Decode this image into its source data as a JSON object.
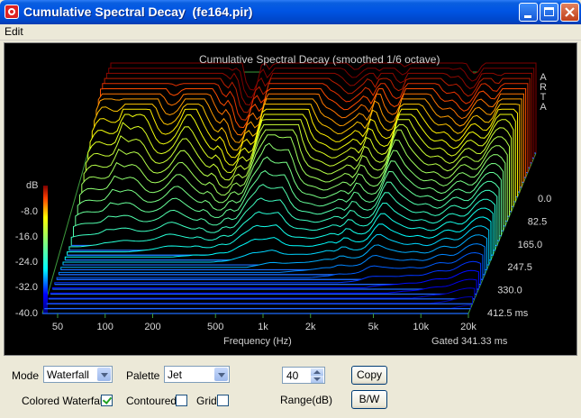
{
  "window": {
    "title": "Cumulative Spectral Decay  (fe164.pir)"
  },
  "menu": {
    "edit": "Edit"
  },
  "plot": {
    "title": "Cumulative Spectral Decay (smoothed 1/6 octave)",
    "watermark": [
      "A",
      "R",
      "T",
      "A"
    ],
    "db_unit": "dB",
    "db_ticks": [
      "-8.0",
      "-16.0",
      "-24.0",
      "-32.0",
      "-40.0"
    ],
    "freq_ticks": [
      "50",
      "100",
      "200",
      "500",
      "1k",
      "2k",
      "5k",
      "10k",
      "20k"
    ],
    "freq_label": "Frequency (Hz)",
    "time_ticks": [
      "0.0",
      "82.5",
      "165.0",
      "247.5",
      "330.0",
      "412.5 ms"
    ],
    "gated": "Gated 341.33 ms"
  },
  "chart_data": {
    "type": "waterfall",
    "title": "Cumulative Spectral Decay (smoothed 1/6 octave)",
    "xlabel": "Frequency (Hz)",
    "x_scale": "log",
    "xlim": [
      40,
      20000
    ],
    "ylabel": "dB",
    "ylim": [
      -40,
      0
    ],
    "time_unit": "ms",
    "time_ticks": [
      0.0,
      82.5,
      165.0,
      247.5,
      330.0,
      412.5
    ],
    "colormap": "Jet",
    "note_gated_ms": 341.33
  },
  "controls": {
    "mode_label": "Mode",
    "mode_value": "Waterfall",
    "palette_label": "Palette",
    "palette_value": "Jet",
    "range_value": "40",
    "range_label": "Range(dB)",
    "copy_label": "Copy",
    "bw_label": "B/W",
    "colored_waterfall_label": "Colored Waterfall",
    "colored_waterfall_checked": true,
    "contoured_label": "Contoured",
    "contoured_checked": false,
    "grid_label": "Grid",
    "grid_checked": false
  }
}
